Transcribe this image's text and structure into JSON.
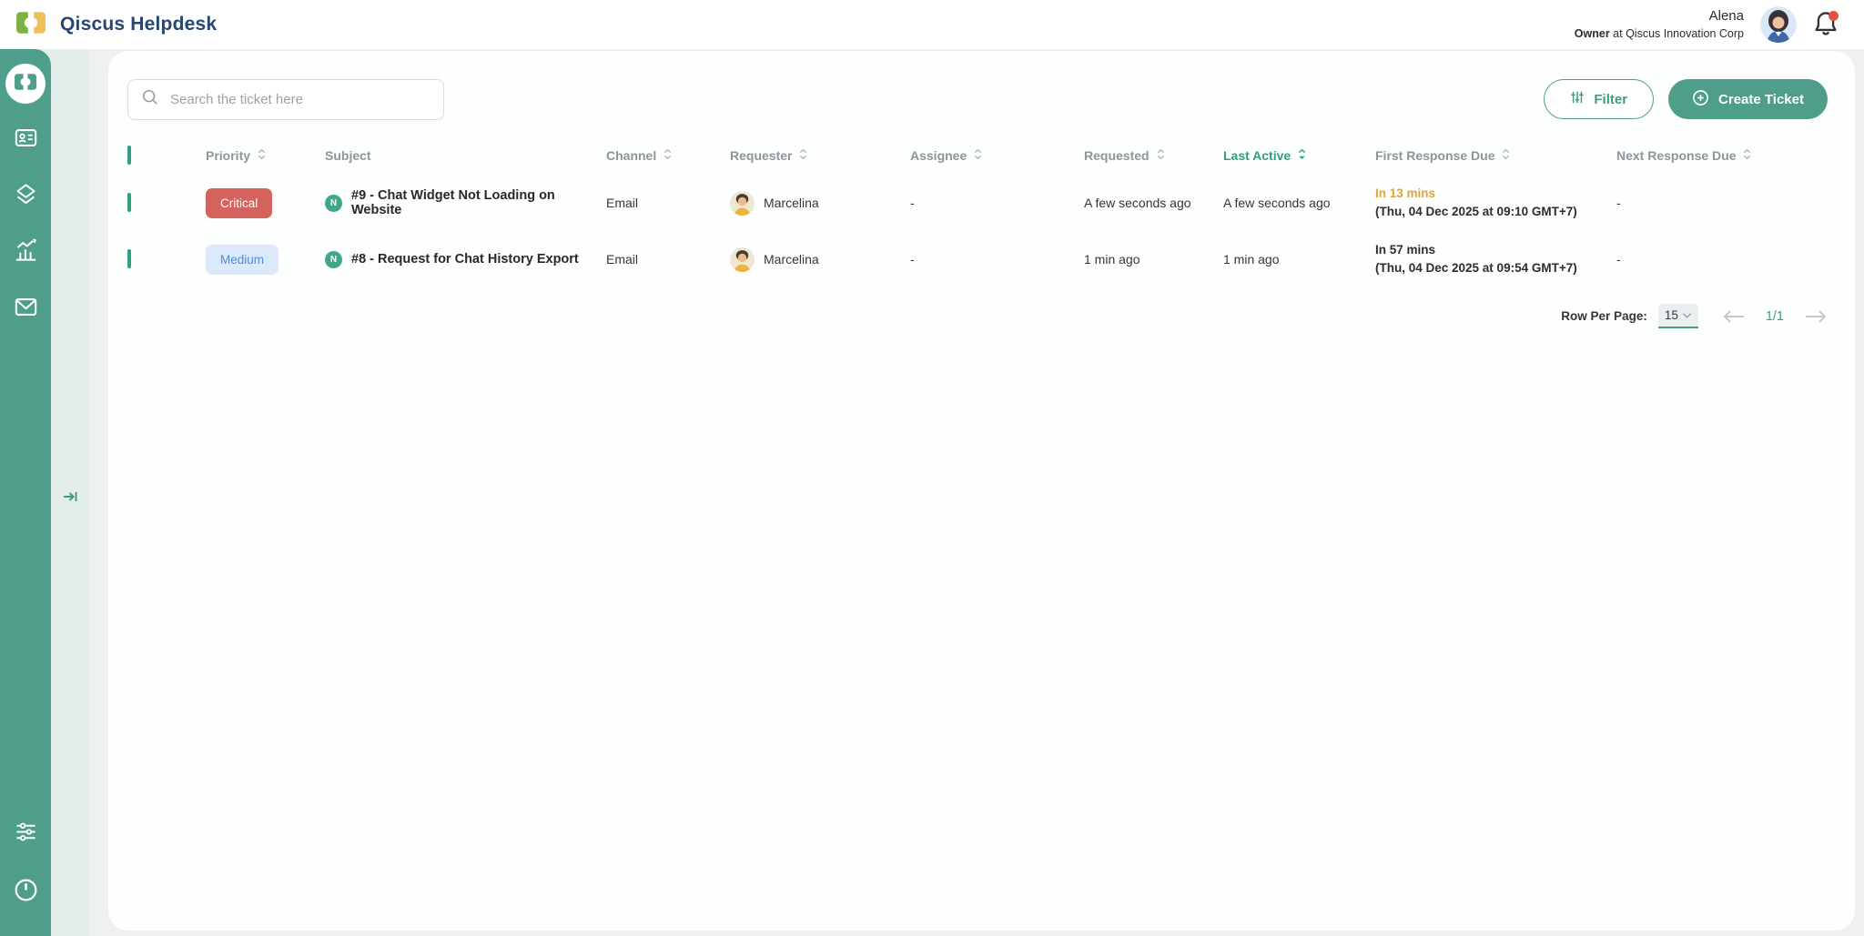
{
  "topbar": {
    "app_title": "Qiscus Helpdesk",
    "user": {
      "name": "Alena",
      "role_bold": "Owner",
      "role_rest": " at Qiscus Innovation Corp"
    },
    "notification": {
      "has_unread_dot": true
    }
  },
  "sidebar": {
    "items": [
      {
        "icon": "ticket-icon",
        "active": true
      },
      {
        "icon": "contact-card-icon",
        "active": false
      },
      {
        "icon": "layers-icon",
        "active": false
      },
      {
        "icon": "analytics-icon",
        "active": false
      },
      {
        "icon": "mail-icon",
        "active": false
      }
    ],
    "bottom_items": [
      {
        "icon": "settings-sliders-icon"
      },
      {
        "icon": "power-icon"
      }
    ],
    "expand_icon": "expand-arrow-icon"
  },
  "toolbar": {
    "search_placeholder": "Search the ticket here",
    "filter_label": "Filter",
    "create_ticket_label": "Create Ticket"
  },
  "table": {
    "columns": [
      {
        "label": "",
        "sortable": false
      },
      {
        "label": "Priority",
        "sortable": true
      },
      {
        "label": "Subject",
        "sortable": false
      },
      {
        "label": "Channel",
        "sortable": true
      },
      {
        "label": "Requester",
        "sortable": true
      },
      {
        "label": "Assignee",
        "sortable": true
      },
      {
        "label": "Requested",
        "sortable": true
      },
      {
        "label": "Last Active",
        "sortable": true,
        "active_sort": true
      },
      {
        "label": "First Response Due",
        "sortable": true
      },
      {
        "label": "Next Response Due",
        "sortable": true
      }
    ],
    "rows": [
      {
        "priority": "Critical",
        "priority_level": "critical",
        "status_badge": "N",
        "subject": "#9 - Chat Widget Not Loading on Website",
        "channel": "Email",
        "requester": "Marcelina",
        "assignee": "-",
        "requested": "A few seconds ago",
        "last_active": "A few seconds ago",
        "first_response_due": "In 13 mins",
        "first_response_due_date": "(Thu, 04 Dec 2025 at 09:10 GMT+7)",
        "first_response_urgent": true,
        "next_response_due": "-"
      },
      {
        "priority": "Medium",
        "priority_level": "medium",
        "status_badge": "N",
        "subject": "#8 - Request for Chat History Export",
        "channel": "Email",
        "requester": "Marcelina",
        "assignee": "-",
        "requested": "1 min ago",
        "last_active": "1 min ago",
        "first_response_due": "In 57 mins",
        "first_response_due_date": "(Thu, 04 Dec 2025 at 09:54 GMT+7)",
        "first_response_urgent": false,
        "next_response_due": "-"
      }
    ]
  },
  "pagination": {
    "rows_per_page_label": "Row Per Page:",
    "rows_per_page_value": "15",
    "page_indicator": "1/1"
  },
  "colors": {
    "accent_green": "#4F9E89",
    "active_sort_green": "#2F9E82",
    "critical_red": "#D4635D",
    "medium_blue_bg": "#DCE9FB",
    "medium_blue_text": "#4B8FE2",
    "warning_orange": "#DFA23E",
    "title_navy": "#274672"
  }
}
